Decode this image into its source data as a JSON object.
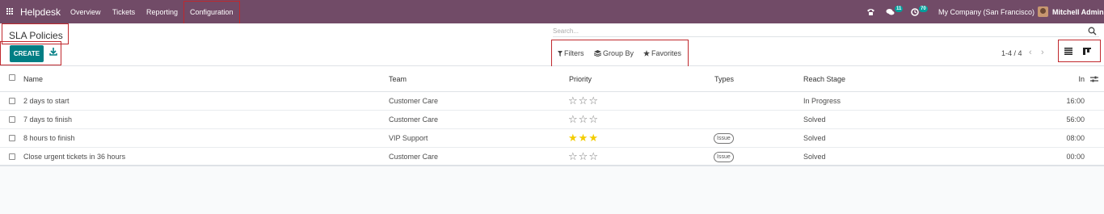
{
  "navbar": {
    "app_name": "Helpdesk",
    "menu": [
      "Overview",
      "Tickets",
      "Reporting",
      "Configuration"
    ],
    "messages_badge": "11",
    "activities_badge": "70",
    "company": "My Company (San Francisco)",
    "user": "Mitchell Admin",
    "color": "#714b67"
  },
  "controlpanel": {
    "title": "SLA Policies",
    "create_label": "CREATE",
    "search_placeholder": "Search...",
    "filters_label": "Filters",
    "groupby_label": "Group By",
    "favorites_label": "Favorites",
    "pager": "1-4 / 4",
    "pager_prev": "‹",
    "pager_next": "›",
    "accent": "#017e84"
  },
  "table": {
    "columns": {
      "name": "Name",
      "team": "Team",
      "priority": "Priority",
      "types": "Types",
      "reach_stage": "Reach Stage",
      "in": "In"
    },
    "rows": [
      {
        "name": "2 days to start",
        "team": "Customer Care",
        "priority": 0,
        "types": "",
        "reach_stage": "In Progress",
        "in": "16:00"
      },
      {
        "name": "7 days to finish",
        "team": "Customer Care",
        "priority": 0,
        "types": "",
        "reach_stage": "Solved",
        "in": "56:00"
      },
      {
        "name": "8 hours to finish",
        "team": "VIP Support",
        "priority": 3,
        "types": "Issue",
        "reach_stage": "Solved",
        "in": "08:00"
      },
      {
        "name": "Close urgent tickets in 36 hours",
        "team": "Customer Care",
        "priority": 0,
        "types": "Issue",
        "reach_stage": "Solved",
        "in": "00:00"
      }
    ]
  }
}
